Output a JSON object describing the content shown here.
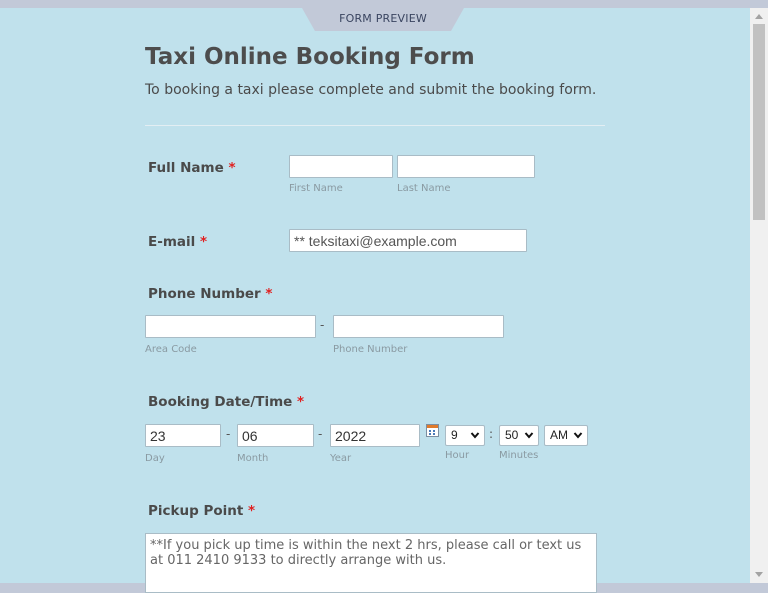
{
  "tab": {
    "label": "FORM PREVIEW"
  },
  "form": {
    "title": "Taxi Online Booking Form",
    "subtitle": "To booking a taxi please complete and submit the booking form.",
    "required_mark": "*",
    "full_name": {
      "label": "Full Name",
      "first_sublabel": "First Name",
      "last_sublabel": "Last Name",
      "first_value": "",
      "last_value": ""
    },
    "email": {
      "label": "E-mail",
      "placeholder": "** teksitaxi@example.com",
      "value": ""
    },
    "phone": {
      "label": "Phone Number",
      "separator": "-",
      "area_sublabel": "Area Code",
      "number_sublabel": "Phone Number",
      "area_value": "",
      "number_value": ""
    },
    "booking": {
      "label": "Booking Date/Time",
      "separator": "-",
      "time_separator": ":",
      "day_value": "23",
      "month_value": "06",
      "year_value": "2022",
      "day_sublabel": "Day",
      "month_sublabel": "Month",
      "year_sublabel": "Year",
      "hour_value": "9",
      "minute_value": "50",
      "ampm_value": "AM",
      "hour_sublabel": "Hour",
      "minutes_sublabel": "Minutes"
    },
    "pickup": {
      "label": "Pickup Point",
      "placeholder": "**If you pick up time is within the next 2 hrs, please call or text us at 011 2410 9133 to directly arrange with us."
    }
  }
}
